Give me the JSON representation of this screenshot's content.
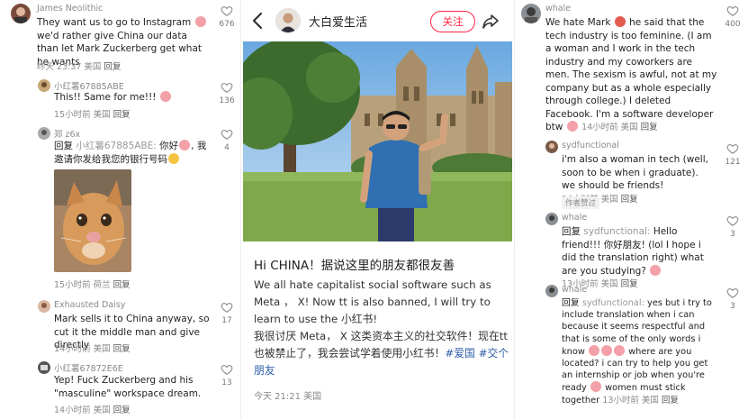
{
  "left_panel": {
    "comments": [
      {
        "user": "James Neolithic",
        "text": "They want us to go to Instagram",
        "text2": "we'd rather give China our data than let Mark Zuckerberg get what he wants",
        "time": "昨天 23:37 美国",
        "reply": "回复",
        "likes": "676"
      },
      {
        "user": "小红薯67885ABE",
        "text": "This!! Same for me!!!",
        "time": "15小时前 美国",
        "reply": "回复",
        "likes": "136"
      },
      {
        "user": "郑 z6x",
        "reply_prefix": "回复",
        "reply_to": "小红薯67885ABE:",
        "text": "你好",
        "text2": "我邀请你发给我您的银行号码",
        "time": "15小时前 荷兰",
        "reply": "回复",
        "likes": "4"
      },
      {
        "user": "Exhausted Daisy",
        "text": "Mark sells it to China anyway, so cut it the middle man and give directly",
        "time": "14小时前 美国",
        "reply": "回复",
        "likes": "17"
      },
      {
        "user": "小红薯67872E6E",
        "text": "Yep! Fuck Zuckerberg and his \"masculine\" workspace dream.",
        "time": "14小时前 美国",
        "reply": "回复",
        "likes": "13"
      }
    ]
  },
  "post": {
    "author": "大白爱生活",
    "follow_label": "关注",
    "title": "Hi CHINA！据说这里的朋友都很友善",
    "body_en": "We all hate capitalist social software such as Meta ， X! Now tt is also banned, I will try to learn to use the 小红书!",
    "body_cn": "我很讨厌 Meta， X 这类资本主义的社交软件！现在tt也被禁止了，我会尝试学着使用小红书！",
    "tags": [
      "#爱国",
      "#交个朋友"
    ],
    "meta": "今天 21:21 美国"
  },
  "right_panel": {
    "comments": [
      {
        "user": "whale",
        "text": "We hate Mark",
        "text2": "he said that the tech industry is too feminine. (I am a woman and I work in the tech industry and my coworkers are men. The sexism is awful, not at my company but as a whole especially through college.) I deleted Facebook. I'm a software developer btw",
        "time": "14小时前 美国",
        "reply": "回复",
        "likes": "400"
      },
      {
        "user": "sydfunctional",
        "text": "i'm also a woman in tech (well, soon to be when i graduate). we should be friends!",
        "time": "14小时前 美国",
        "reply": "回复",
        "badge": "作者赞过",
        "likes": "121"
      },
      {
        "user": "whale",
        "reply_prefix": "回复",
        "reply_to": "sydfunctional:",
        "text": "Hello friend!!! 你好朋友! (lol I hope i did the translation right) what are you studying?",
        "time": "13小时前 美国",
        "reply": "回复",
        "likes": "3"
      },
      {
        "user": "whale",
        "reply_prefix": "回复",
        "reply_to": "sydfunctional:",
        "text": "yes but i try to include translation when i can because it seems respectful and that is some of the only words i know",
        "text2": "where are you located? i can try to help you get an internship or job when you're ready",
        "text3": "women must stick together",
        "time": "13小时前 美国",
        "reply": "回复",
        "likes": "3"
      }
    ]
  }
}
